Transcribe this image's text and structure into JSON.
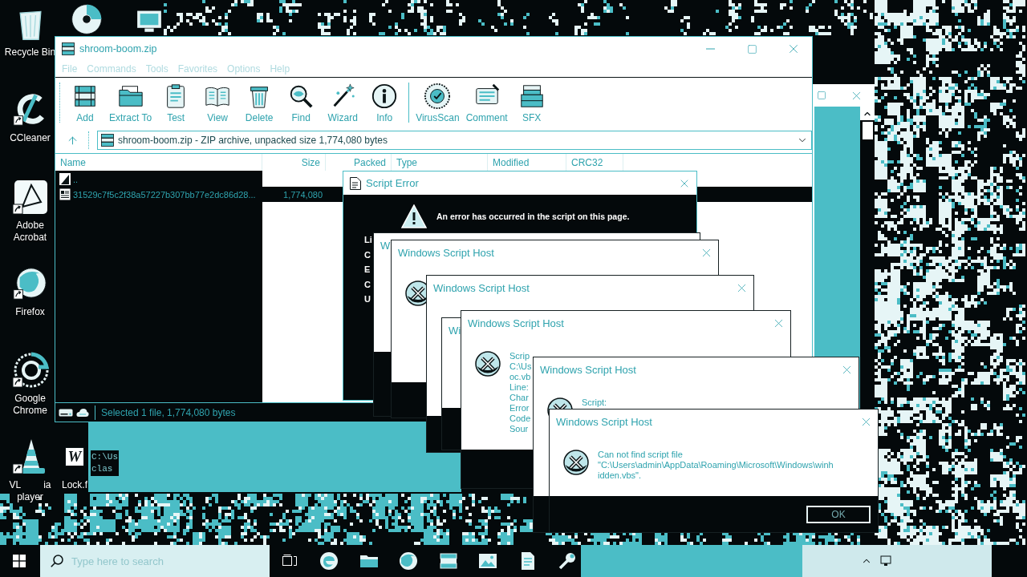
{
  "desktop_icons": [
    {
      "kind": "bin",
      "lines": [
        [
          "Recycle Bin"
        ]
      ]
    },
    {
      "kind": "swirl",
      "lines": [
        [
          "CCleaner"
        ]
      ]
    },
    {
      "kind": "pdf",
      "lines": [
        [
          "Adobe"
        ],
        [
          "Acrobat"
        ]
      ]
    },
    {
      "kind": "globe",
      "lines": [
        [
          "Firefox"
        ]
      ]
    },
    {
      "kind": "ring",
      "lines": [
        [
          "Google"
        ],
        [
          "Chrome"
        ]
      ]
    },
    {
      "kind": "cone",
      "lines": [
        [
          "VL",
          "ia"
        ],
        [
          "player"
        ]
      ]
    },
    {
      "kind": "document",
      "icon_text": "W",
      "lines": [
        [
          "Lock.f"
        ]
      ]
    },
    {
      "kind": "disc"
    },
    {
      "kind": "app"
    }
  ],
  "archiver": {
    "title": "shroom-boom.zip",
    "menu": [
      "File",
      "Commands",
      "Tools",
      "Favorites",
      "Options",
      "Help"
    ],
    "toolbar_groups": [
      [
        {
          "kind": "add",
          "label": "Add"
        },
        {
          "kind": "extract",
          "label": "Extract To"
        },
        {
          "kind": "test",
          "label": "Test"
        },
        {
          "kind": "view",
          "label": "View"
        },
        {
          "kind": "delete",
          "label": "Delete"
        },
        {
          "kind": "find",
          "label": "Find"
        },
        {
          "kind": "wizard",
          "label": "Wizard"
        },
        {
          "kind": "info",
          "label": "Info"
        }
      ],
      [
        {
          "kind": "virusscan",
          "label": "VirusScan"
        },
        {
          "kind": "comment",
          "label": "Comment"
        },
        {
          "kind": "sfx",
          "label": "SFX"
        }
      ]
    ],
    "address": "shroom-boom.zip - ZIP archive, unpacked size 1,774,080 bytes",
    "columns": [
      {
        "label": "Name",
        "kind": "text"
      },
      {
        "label": "Size",
        "kind": "number"
      },
      {
        "label": "Packed",
        "kind": "number"
      },
      {
        "label": "Type",
        "kind": "text"
      },
      {
        "label": "Modified",
        "kind": "text"
      },
      {
        "label": "CRC32",
        "kind": "text"
      }
    ],
    "rows": [
      {
        "kind": "up",
        "selected": false,
        "cells": [
          ".."
        ]
      },
      {
        "kind": "file",
        "selected": true,
        "cells": [
          "31529c7f5c2f38a57227b307bb77e2dc86d28...",
          "1,774,080"
        ]
      }
    ],
    "status": "Selected 1 file, 1,774,080 bytes"
  },
  "script_error": {
    "title": "Script Error",
    "message": "An error has occurred in the script on this page.",
    "field_fragments": [
      "Li",
      "C",
      "E",
      "C",
      "U"
    ]
  },
  "script_host_dialogs": [
    {
      "title": "W"
    },
    {
      "title": "Windows Script Host"
    },
    {
      "title": "Windows Script Host"
    },
    {
      "title": "Wi"
    },
    {
      "title": "Windows Script Host",
      "message_lines": [
        "Scrip",
        "C:\\Us",
        "oc.vb",
        "Line:",
        "Char",
        "Error",
        "Code",
        "Sour"
      ]
    },
    {
      "title": "Windows Script Host",
      "message_lines": [
        "Script:"
      ]
    },
    {
      "title": "Windows Script Host",
      "message_lines": [
        "Can not find script file",
        "\"C:\\Users\\admin\\AppData\\Roaming\\Microsoft\\Windows\\winh",
        "idden.vbs\"."
      ],
      "buttons": [
        "OK"
      ]
    }
  ],
  "console_fragment": [
    "C:\\Us",
    "clas"
  ],
  "taskbar": {
    "search_placeholder": "Type here to search"
  }
}
